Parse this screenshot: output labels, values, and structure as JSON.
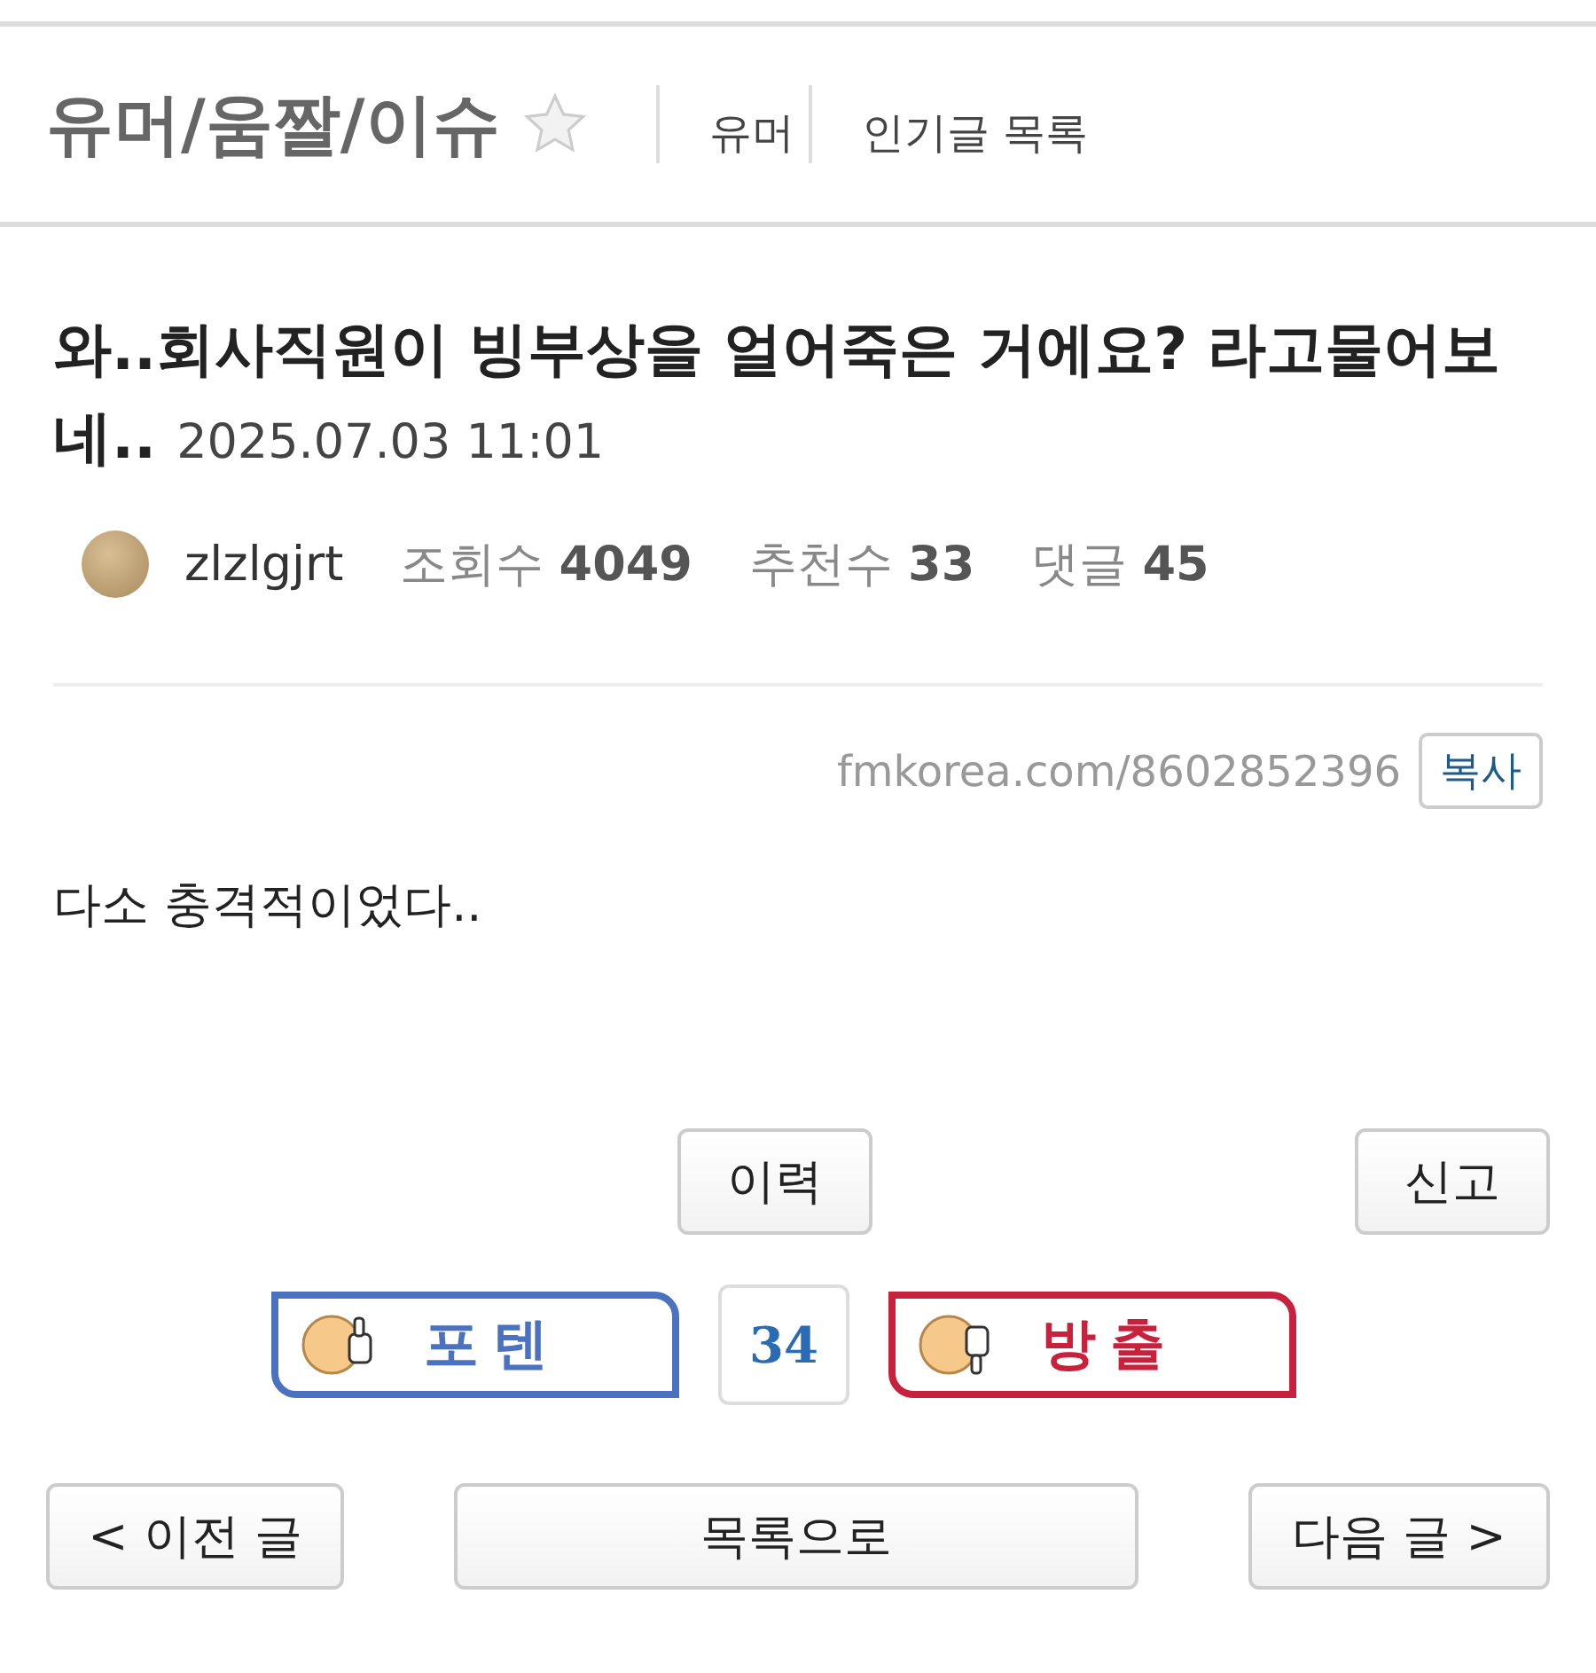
{
  "header": {
    "board_title": "유머/움짤/이슈",
    "favorite": false,
    "links": [
      "유머",
      "인기글 목록"
    ]
  },
  "post": {
    "title": "와..회사직원이 빙부상을 얼어죽은 거에요? 라고물어보네..",
    "date": "2025.07.03 11:01",
    "author": "zlzlgjrt",
    "stats": [
      {
        "label": "조회수",
        "value": "4049"
      },
      {
        "label": "추천수",
        "value": "33"
      },
      {
        "label": "댓글",
        "value": "45"
      }
    ],
    "url": "fmkorea.com/8602852396",
    "copy_button": "복사",
    "body": "다소 충격적이었다.."
  },
  "actions": [
    "이력",
    "신고"
  ],
  "votes": [
    {
      "kind": "up",
      "label": "포텐",
      "color": "#4a72c0"
    },
    {
      "kind": "count",
      "label": "34"
    },
    {
      "kind": "down",
      "label": "방출",
      "color": "#c8213d"
    }
  ],
  "nav": {
    "prev": "< 이전 글",
    "list": "목록으로",
    "next": "다음 글 >"
  }
}
